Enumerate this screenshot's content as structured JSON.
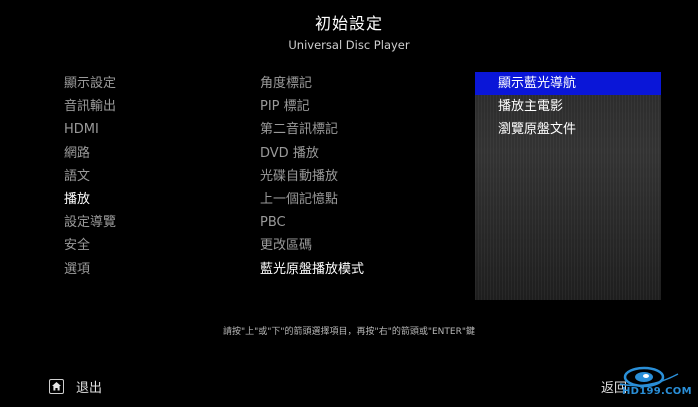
{
  "header": {
    "title": "初始設定",
    "subtitle": "Universal Disc Player"
  },
  "main_menu": [
    {
      "label": "顯示設定",
      "active": false
    },
    {
      "label": "音訊輸出",
      "active": false
    },
    {
      "label": "HDMI",
      "active": false
    },
    {
      "label": "網路",
      "active": false
    },
    {
      "label": "語文",
      "active": false
    },
    {
      "label": "播放",
      "active": true
    },
    {
      "label": "設定導覽",
      "active": false
    },
    {
      "label": "安全",
      "active": false
    },
    {
      "label": "選項",
      "active": false
    }
  ],
  "sub_menu": [
    {
      "label": "角度標記",
      "active": false
    },
    {
      "label": "PIP 標記",
      "active": false
    },
    {
      "label": "第二音訊標記",
      "active": false
    },
    {
      "label": "DVD 播放",
      "active": false
    },
    {
      "label": "光碟自動播放",
      "active": false
    },
    {
      "label": "上一個記憶點",
      "active": false
    },
    {
      "label": "PBC",
      "active": false
    },
    {
      "label": "更改區碼",
      "active": false
    },
    {
      "label": "藍光原盤播放模式",
      "active": true
    }
  ],
  "options": [
    {
      "label": "顯示藍光導航",
      "selected": true
    },
    {
      "label": "播放主電影",
      "selected": false
    },
    {
      "label": "瀏覽原盤文件",
      "selected": false
    }
  ],
  "hint": "請按\"上\"或\"下\"的箭頭選擇項目，再按\"右\"的箭頭或\"ENTER\"鍵",
  "footer": {
    "exit_label": "退出",
    "exit_icon": "home-icon",
    "back_label": "返回"
  },
  "watermark": {
    "text": "HD199.COM"
  },
  "colors": {
    "background": "#000000",
    "selection": "#0a16d8",
    "inactive_text": "#9a9a9a",
    "watermark": "#2a8fd8"
  }
}
